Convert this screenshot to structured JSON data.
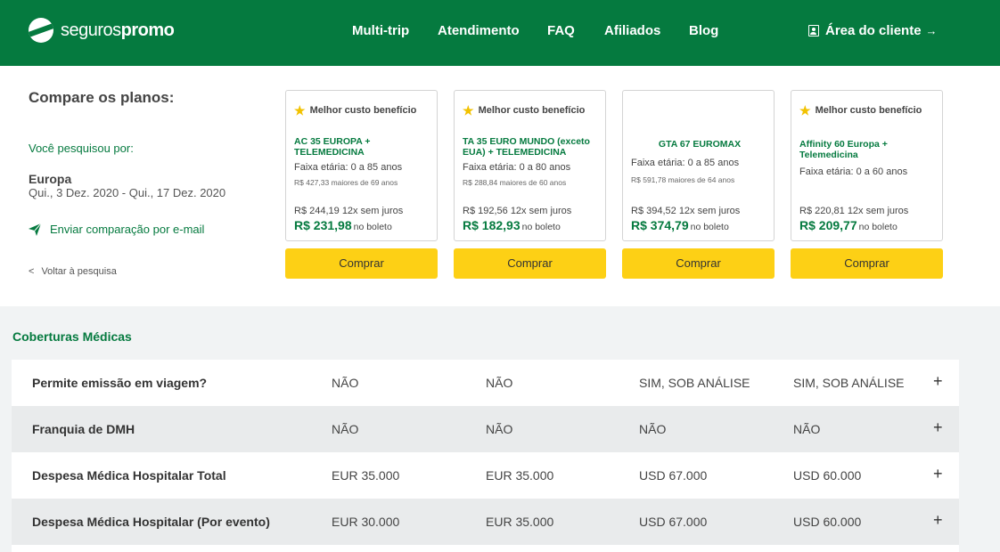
{
  "header": {
    "logo_light": "seguros",
    "logo_bold": "promo",
    "nav": [
      "Multi-trip",
      "Atendimento",
      "FAQ",
      "Afiliados",
      "Blog"
    ],
    "client_area": "Área do cliente",
    "client_arrow": "→"
  },
  "sidebar": {
    "title": "Compare os planos:",
    "search_label": "Você pesquisou por:",
    "destination": "Europa",
    "dates": "Qui., 3 Dez. 2020 - Qui., 17 Dez. 2020",
    "email_link": "Enviar comparação por e-mail",
    "back_link": "Voltar à pesquisa",
    "back_glyph": "<"
  },
  "plans": [
    {
      "badge": "Melhor custo benefício",
      "name": "AC 35 EUROPA + TELEMEDICINA",
      "age": "Faixa etária: 0 a 85 anos",
      "older": "R$ 427,33 maiores de 69 anos",
      "installments": "R$ 244,19 12x sem juros",
      "price": "R$ 231,98",
      "price_suffix": "no boleto",
      "buy": "Comprar"
    },
    {
      "badge": "Melhor custo benefício",
      "name": "TA 35 EURO MUNDO (exceto EUA) + TELEMEDICINA",
      "age": "Faixa etária: 0 a 80 anos",
      "older": "R$ 288,84 maiores de 60 anos",
      "installments": "R$ 192,56 12x sem juros",
      "price": "R$ 182,93",
      "price_suffix": "no boleto",
      "buy": "Comprar"
    },
    {
      "badge": "",
      "name": "GTA 67 EUROMAX",
      "age": "Faixa etária: 0 a 85 anos",
      "older": "R$ 591,78 maiores de 64 anos",
      "installments": "R$ 394,52 12x sem juros",
      "price": "R$ 374,79",
      "price_suffix": "no boleto",
      "buy": "Comprar"
    },
    {
      "badge": "Melhor custo benefício",
      "name": "Affinity 60 Europa + Telemedicina",
      "age": "Faixa etária: 0 a 60 anos",
      "older": "",
      "installments": "R$ 220,81 12x sem juros",
      "price": "R$ 209,77",
      "price_suffix": "no boleto",
      "buy": "Comprar"
    }
  ],
  "coverage": {
    "title": "Coberturas Médicas",
    "expand_glyph": "+",
    "rows": [
      {
        "label": "Permite emissão em viagem?",
        "values": [
          "NÃO",
          "NÃO",
          "SIM, SOB ANÁLISE",
          "SIM, SOB ANÁLISE"
        ]
      },
      {
        "label": "Franquia de DMH",
        "values": [
          "NÃO",
          "NÃO",
          "NÃO",
          "NÃO"
        ]
      },
      {
        "label": "Despesa Médica Hospitalar Total",
        "values": [
          "EUR 35.000",
          "EUR 35.000",
          "USD 67.000",
          "USD 60.000"
        ]
      },
      {
        "label": "Despesa Médica Hospitalar (Por evento)",
        "values": [
          "EUR 30.000",
          "EUR 35.000",
          "USD 67.000",
          "USD 60.000"
        ]
      }
    ]
  },
  "colors": {
    "brand_green": "#057a3f",
    "buy_yellow": "#fdd015",
    "star_yellow": "#f2c200"
  }
}
